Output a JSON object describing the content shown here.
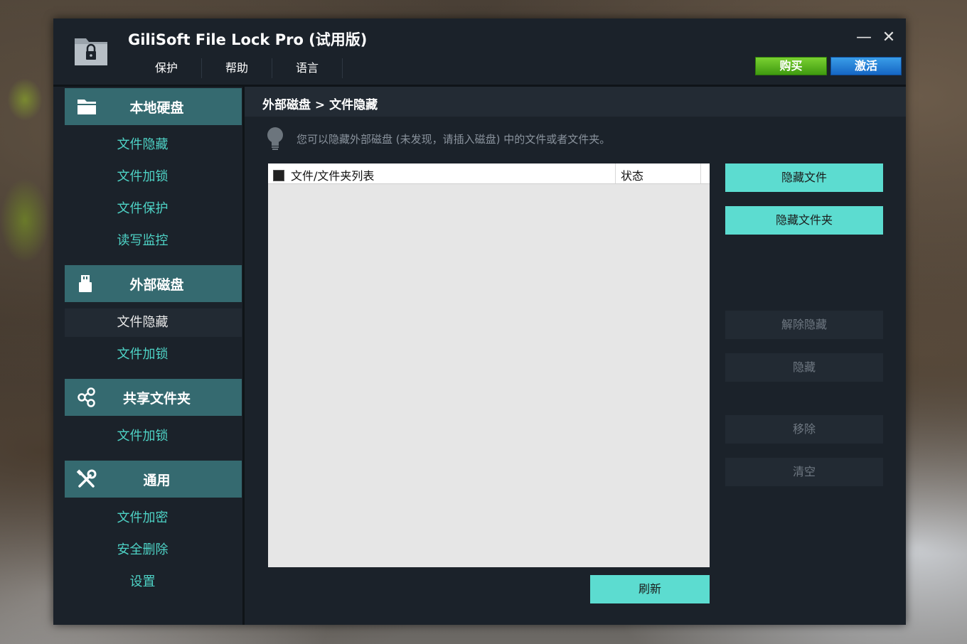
{
  "app": {
    "title": "GiliSoft File Lock Pro (试用版)",
    "menu": [
      "保护",
      "帮助",
      "语言"
    ],
    "buy_label": "购买",
    "activate_label": "激活",
    "minimize_glyph": "—",
    "close_glyph": "✕"
  },
  "sidebar": {
    "sections": [
      {
        "label": "本地硬盘",
        "icon": "folder-icon",
        "items": [
          "文件隐藏",
          "文件加锁",
          "文件保护",
          "读写监控"
        ]
      },
      {
        "label": "外部磁盘",
        "icon": "usb-drive-icon",
        "items": [
          "文件隐藏",
          "文件加锁"
        ],
        "active_item": 0
      },
      {
        "label": "共享文件夹",
        "icon": "share-icon",
        "items": [
          "文件加锁"
        ]
      },
      {
        "label": "通用",
        "icon": "tools-icon",
        "items": [
          "文件加密",
          "安全删除",
          "设置"
        ]
      }
    ]
  },
  "content": {
    "breadcrumb": "外部磁盘 > 文件隐藏",
    "tip": "您可以隐藏外部磁盘 (未发现，请插入磁盘) 中的文件或者文件夹。",
    "list": {
      "col_name": "文件/文件夹列表",
      "col_status": "状态"
    },
    "buttons": {
      "hide_file": "隐藏文件",
      "hide_folder": "隐藏文件夹",
      "unhide": "解除隐藏",
      "hide": "隐藏",
      "remove": "移除",
      "clear": "清空",
      "refresh": "刷新"
    }
  },
  "colors": {
    "accent": "#5cdcd0",
    "section_header": "#356a70",
    "sub_item_text": "#4ed3c6",
    "buy_green": "#4fae1a",
    "activate_blue": "#1a78d6"
  }
}
